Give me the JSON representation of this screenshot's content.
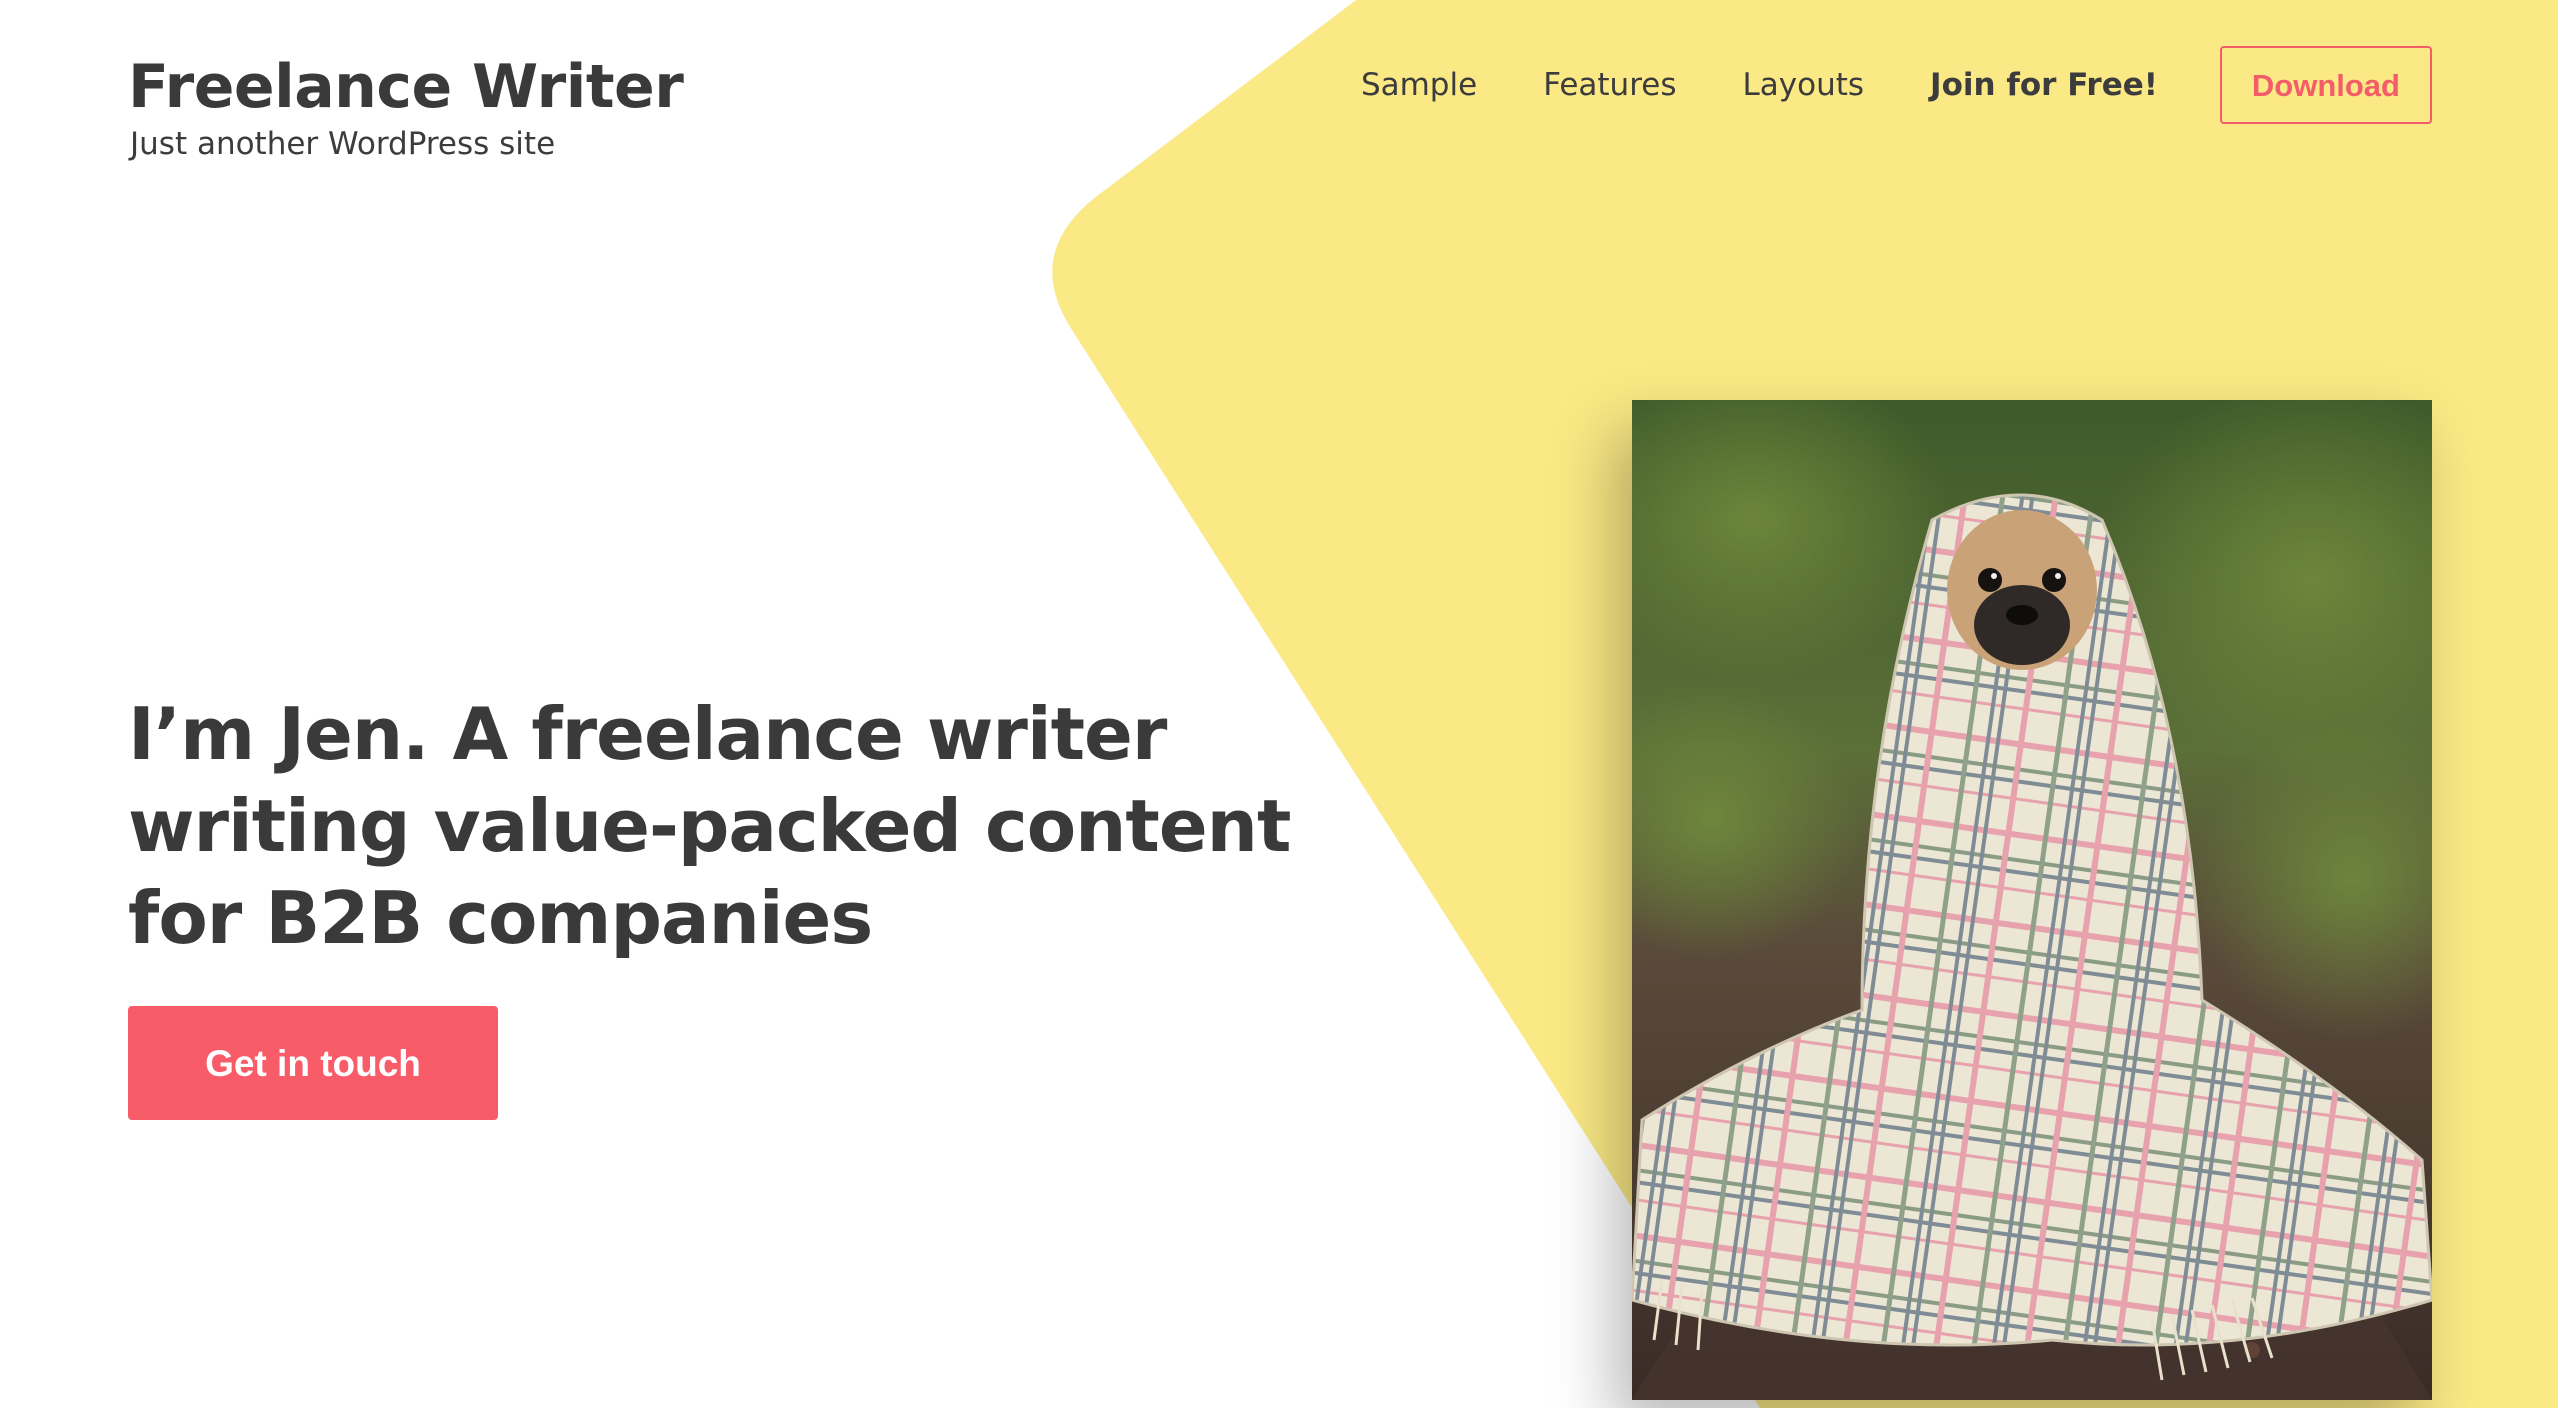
{
  "site": {
    "title": "Freelance Writer",
    "tagline": "Just another WordPress site"
  },
  "nav": {
    "items": [
      {
        "label": "Sample"
      },
      {
        "label": "Features"
      },
      {
        "label": "Layouts"
      },
      {
        "label": "Join for Free!"
      }
    ],
    "download_label": "Download"
  },
  "hero": {
    "heading": "I’m Jen. A freelance writer writing value-packed content for B2B companies",
    "cta_label": "Get in touch",
    "image_subject": "pug wrapped in a plaid blanket sitting on a forest path"
  },
  "colors": {
    "accent": "#f95c69",
    "background_shape": "#fbe985",
    "text": "#3a3a3a",
    "background": "#ffffff"
  },
  "icons": {}
}
